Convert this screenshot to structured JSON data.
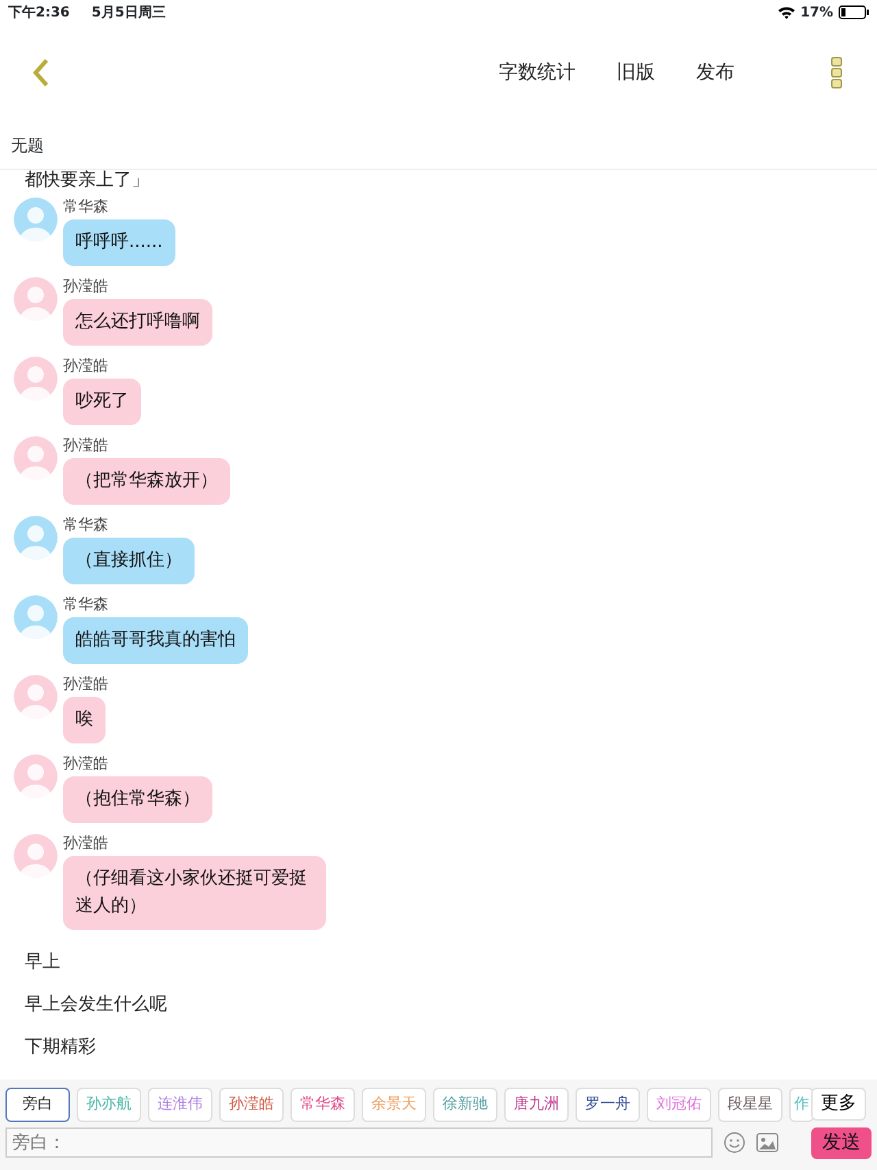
{
  "status_bar": {
    "time": "下午2:36",
    "date": "5月5日周三",
    "battery": "17%"
  },
  "header": {
    "actions": [
      "字数统计",
      "旧版",
      "发布"
    ]
  },
  "title": "无题",
  "story": [
    {
      "kind": "narration",
      "text": "都快要亲上了」"
    },
    {
      "kind": "message",
      "speaker": "常华森",
      "text": "呼呼呼......",
      "color": "#a8def8"
    },
    {
      "kind": "message",
      "speaker": "孙滢皓",
      "text": "怎么还打呼噜啊",
      "color": "#fbd0da"
    },
    {
      "kind": "message",
      "speaker": "孙滢皓",
      "text": "吵死了",
      "color": "#fbd0da"
    },
    {
      "kind": "message",
      "speaker": "孙滢皓",
      "text": "（把常华森放开）",
      "color": "#fbd0da"
    },
    {
      "kind": "message",
      "speaker": "常华森",
      "text": "（直接抓住）",
      "color": "#a8def8"
    },
    {
      "kind": "message",
      "speaker": "常华森",
      "text": "皓皓哥哥我真的害怕",
      "color": "#a8def8"
    },
    {
      "kind": "message",
      "speaker": "孙滢皓",
      "text": "唉",
      "color": "#fbd0da"
    },
    {
      "kind": "message",
      "speaker": "孙滢皓",
      "text": "（抱住常华森）",
      "color": "#fbd0da"
    },
    {
      "kind": "message",
      "speaker": "孙滢皓",
      "text": "（仔细看这小家伙还挺可爱挺迷人的）",
      "color": "#fbd0da"
    },
    {
      "kind": "narration",
      "text": "早上"
    },
    {
      "kind": "narration",
      "text": "早上会发生什么呢"
    },
    {
      "kind": "narration",
      "text": "下期精彩"
    }
  ],
  "characters": [
    {
      "name": "旁白",
      "color": "#222222",
      "selected": true
    },
    {
      "name": "孙亦航",
      "color": "#45b5a5",
      "selected": false
    },
    {
      "name": "连淮伟",
      "color": "#b080e0",
      "selected": false
    },
    {
      "name": "孙滢皓",
      "color": "#d05a45",
      "selected": false
    },
    {
      "name": "常华森",
      "color": "#e04a88",
      "selected": false
    },
    {
      "name": "余景天",
      "color": "#f0a060",
      "selected": false
    },
    {
      "name": "徐新驰",
      "color": "#55a0a5",
      "selected": false
    },
    {
      "name": "唐九洲",
      "color": "#c03890",
      "selected": false
    },
    {
      "name": "罗一舟",
      "color": "#2c4890",
      "selected": false
    },
    {
      "name": "刘冠佑",
      "color": "#e070e0",
      "selected": false
    },
    {
      "name": "段星星",
      "color": "#6a5a5a",
      "selected": false
    },
    {
      "name": "作",
      "color": "#50c0c0",
      "selected": false
    }
  ],
  "more_button": "更多",
  "input": {
    "placeholder": "旁白："
  },
  "send_button": "发送"
}
